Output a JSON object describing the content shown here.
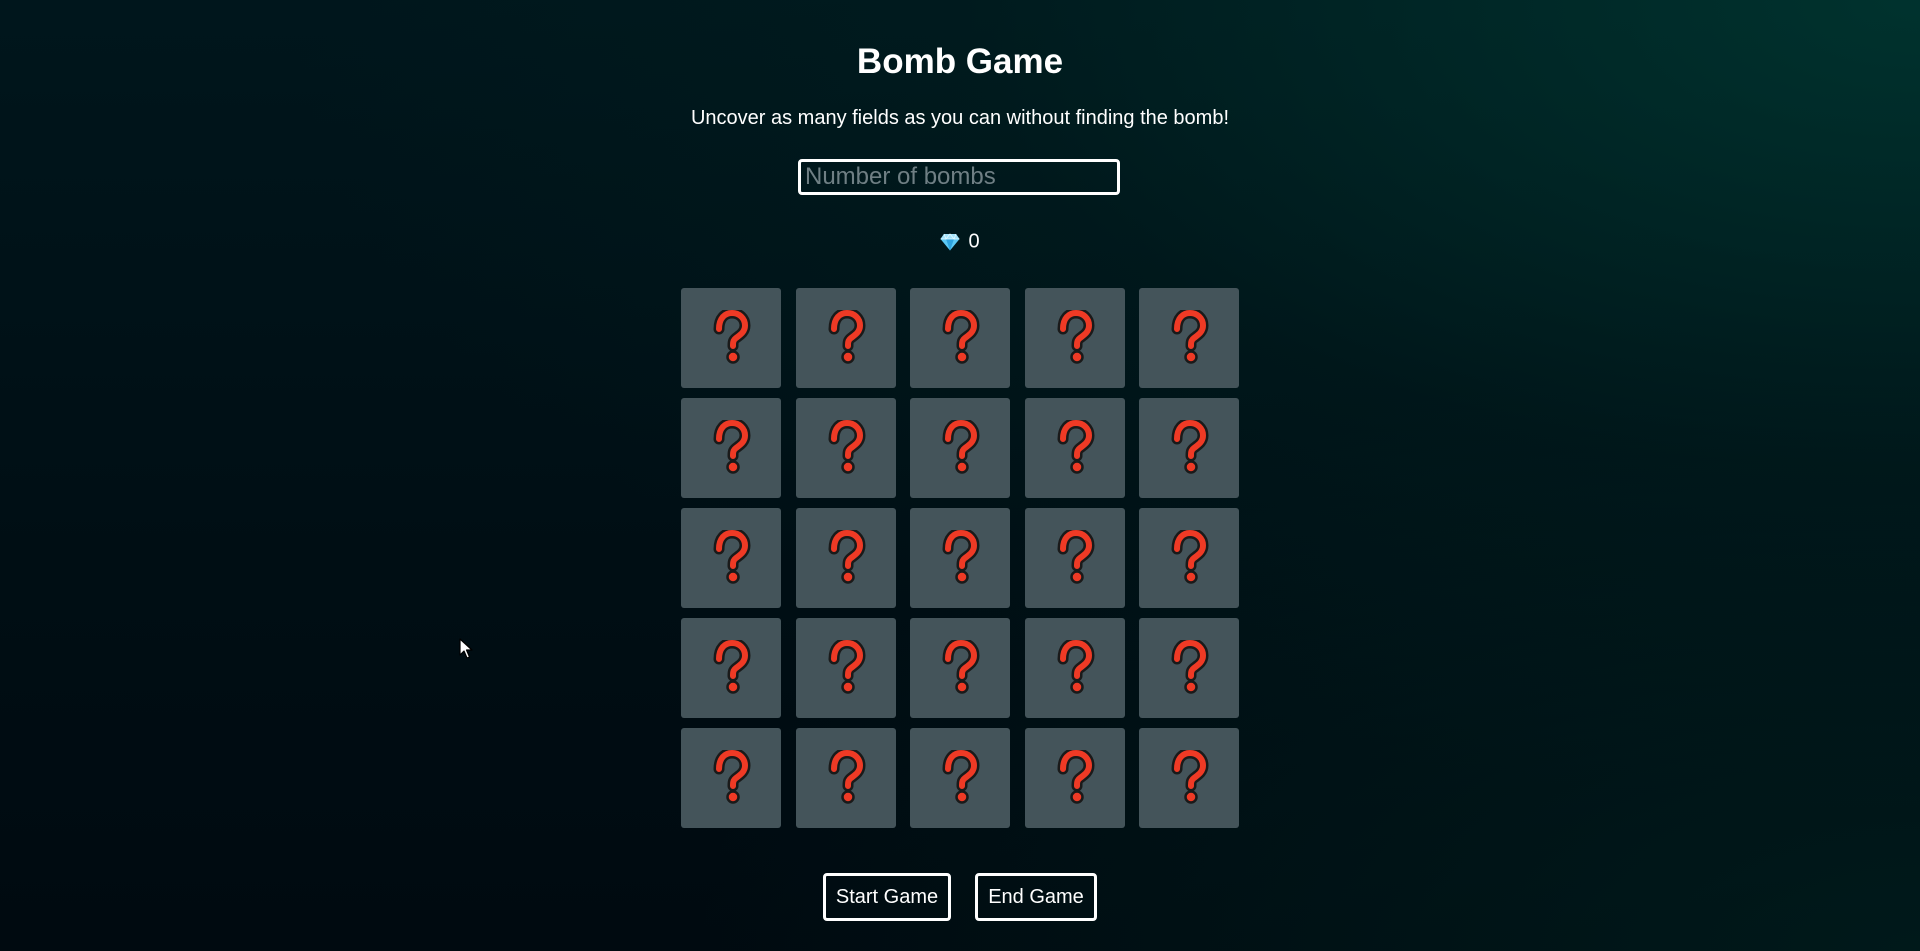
{
  "game": {
    "title": "Bomb Game",
    "subtitle": "Uncover as many fields as you can without finding the bomb!"
  },
  "bomb_input": {
    "placeholder": "Number of bombs",
    "value": ""
  },
  "score": {
    "icon": "gem-icon",
    "value": "0"
  },
  "board": {
    "rows": 5,
    "cols": 5,
    "tile_state": "hidden",
    "tile_icon": "question-mark-icon"
  },
  "buttons": {
    "start_label": "Start Game",
    "end_label": "End Game"
  },
  "colors": {
    "tile": "#44545a",
    "question_mark": "#ef3a25",
    "gem": "#5bc8f5",
    "text": "#ffffff"
  }
}
